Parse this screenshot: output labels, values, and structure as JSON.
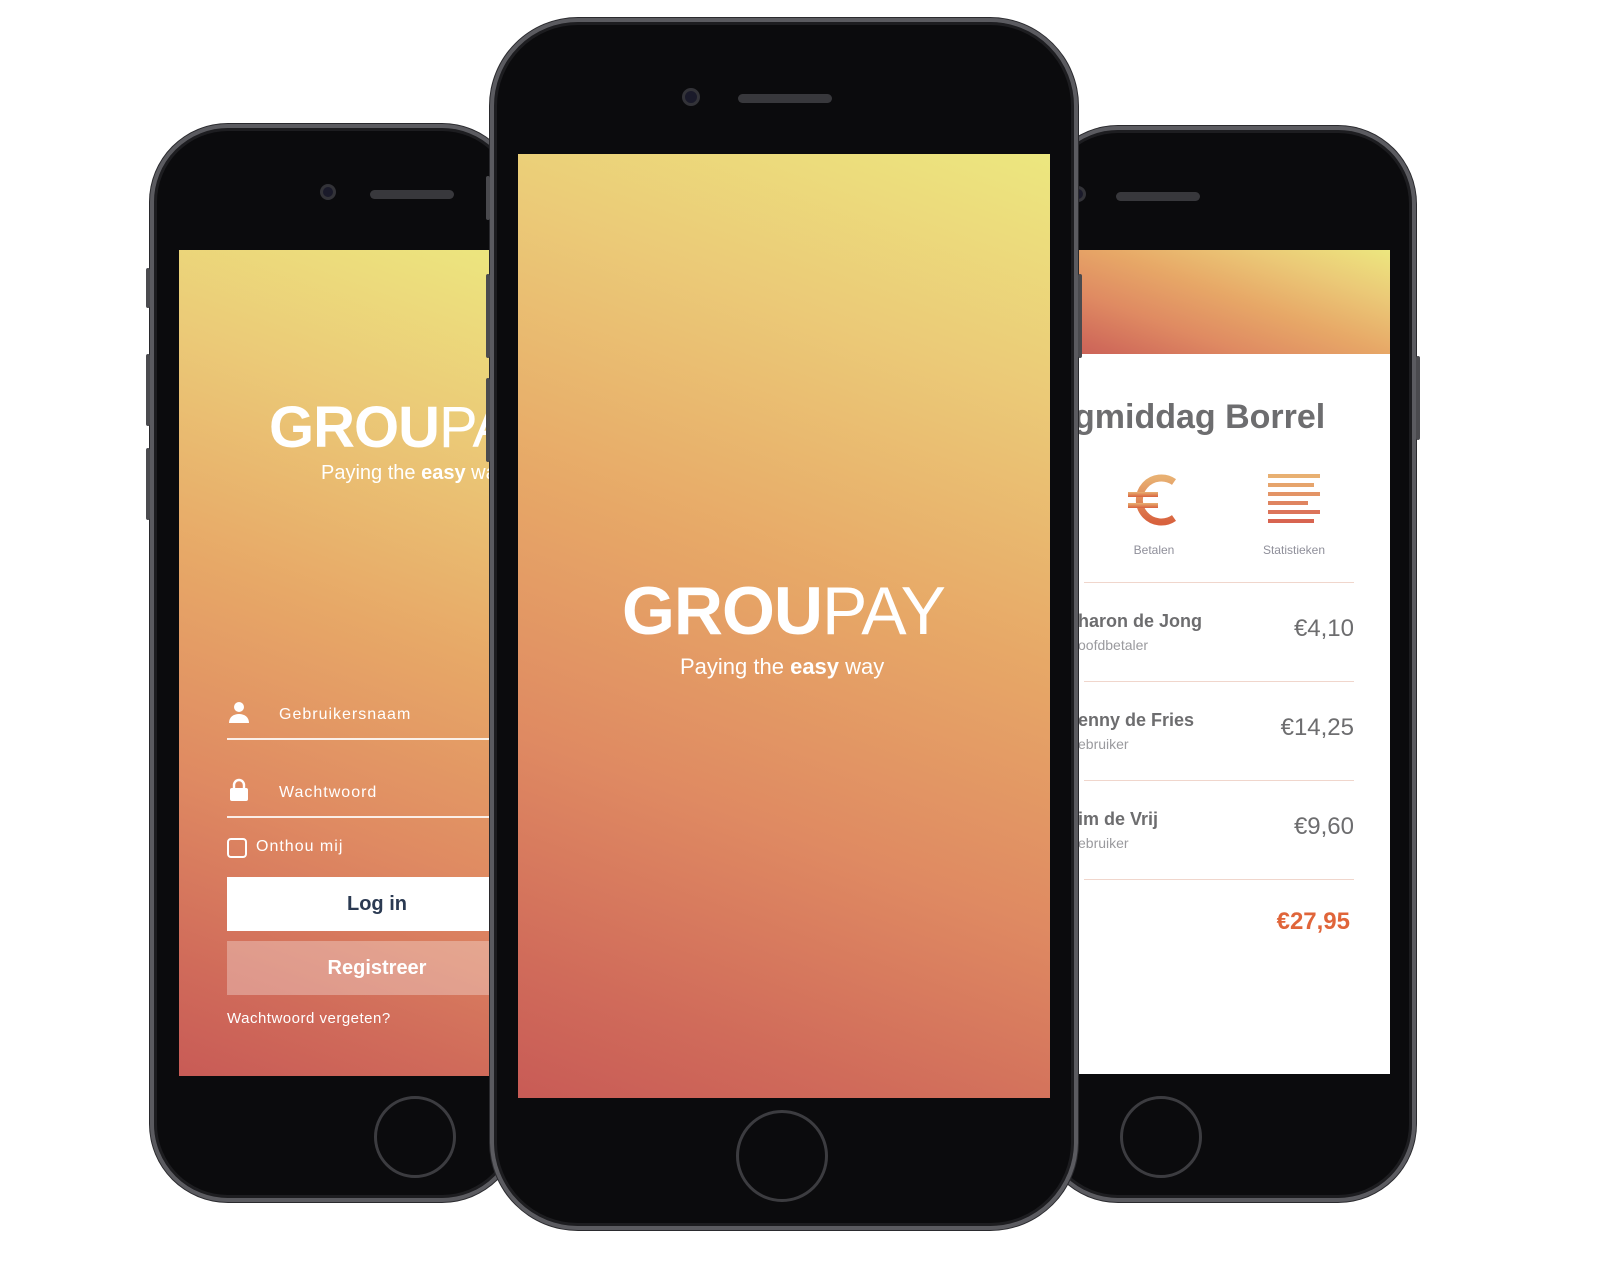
{
  "brand": {
    "logo_bold": "GROU",
    "logo_light": "PAY",
    "tagline_pre": "Paying the ",
    "tagline_bold": "easy",
    "tagline_post": " way"
  },
  "login": {
    "username_placeholder": "Gebruikersnaam",
    "password_placeholder": "Wachtwoord",
    "remember_label": "Onthou mij",
    "login_button": "Log in",
    "register_button": "Registreer",
    "forgot_link": "Wachtwoord vergeten?"
  },
  "event": {
    "title": "gmiddag Borrel",
    "menu": [
      {
        "label": "Betalen",
        "icon": "euro-icon"
      },
      {
        "label": "Statistieken",
        "icon": "statistics-icon"
      }
    ],
    "members": [
      {
        "name": "haron de Jong",
        "role": "oofdbetaler",
        "amount": "€4,10"
      },
      {
        "name": "enny de Fries",
        "role": "ebruiker",
        "amount": "€14,25"
      },
      {
        "name": "im de Vrij",
        "role": "ebruiker",
        "amount": "€9,60"
      }
    ],
    "total": "€27,95",
    "accent": "#e0653a"
  }
}
